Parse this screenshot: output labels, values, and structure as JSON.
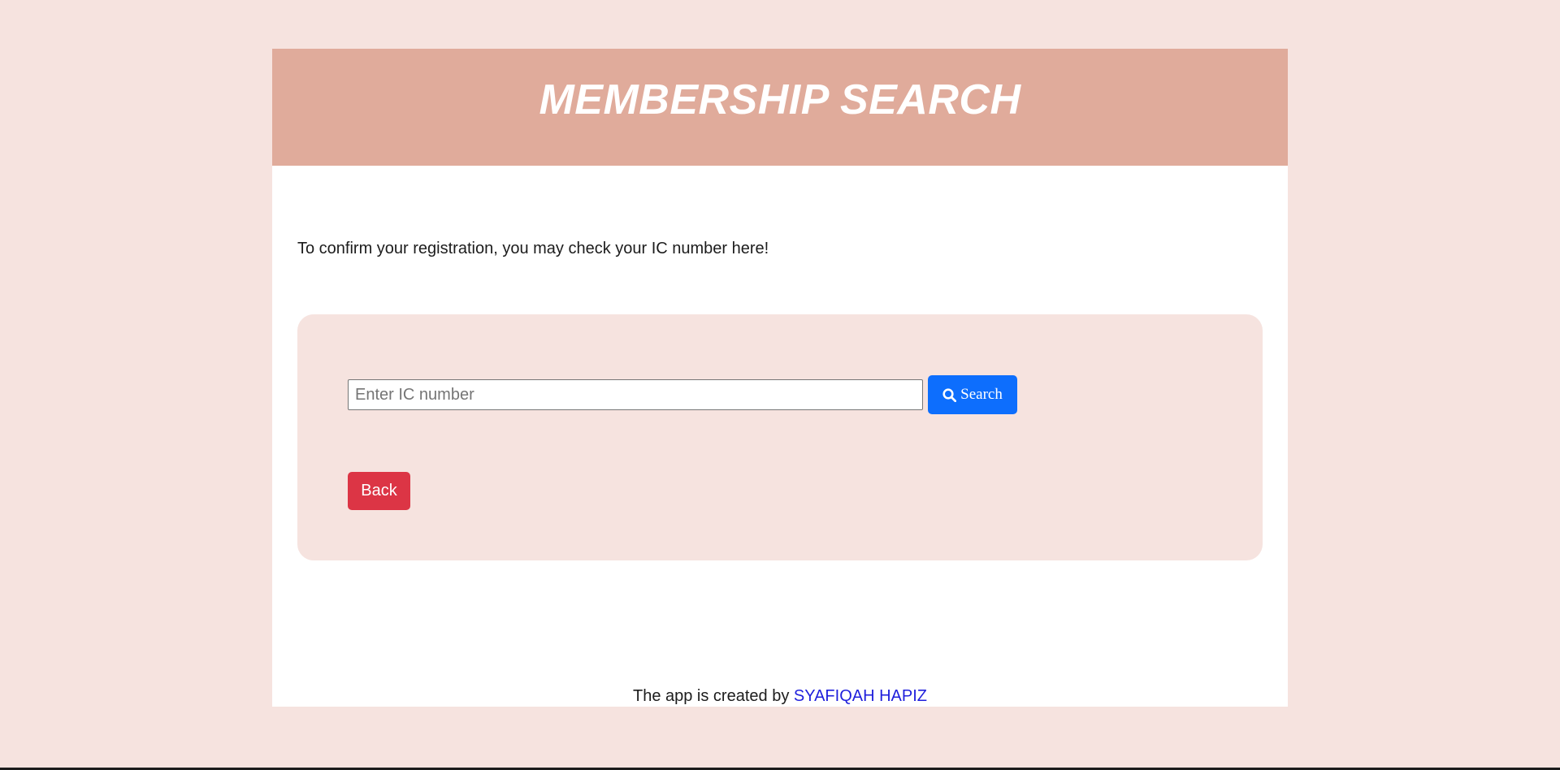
{
  "header": {
    "title": "MEMBERSHIP SEARCH"
  },
  "main": {
    "intro_text": "To confirm your registration, you may check your IC number here!"
  },
  "search": {
    "value": "",
    "placeholder": "Enter IC number",
    "button_label": "Search",
    "button_icon": "search-icon"
  },
  "actions": {
    "back_label": "Back"
  },
  "footer": {
    "text": "The app is created by",
    "author_link": "SYAFIQAH HAPIZ"
  },
  "colors": {
    "page_background": "#f6e3df",
    "header_background": "#e0ab9b",
    "search_button": "#0d6efd",
    "back_button": "#dc3545",
    "link": "#1f1fdc"
  }
}
